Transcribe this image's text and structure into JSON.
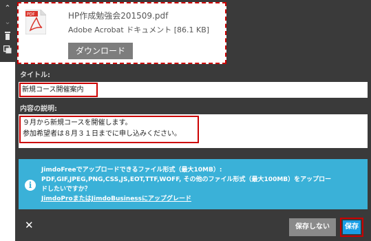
{
  "toolbar": {
    "icons": [
      "chevron-up-icon",
      "chevron-down-icon",
      "trash-icon",
      "duplicate-icon"
    ],
    "up_glyph": "⌃",
    "down_glyph": "⌄",
    "trash_glyph": "🗑",
    "copy_glyph": "⧉"
  },
  "file": {
    "icon_label": "PDF",
    "name": "HP作成勉強会201509.pdf",
    "type": "Adobe Acrobat ドキュメント [86.1 KB]",
    "download_label": "ダウンロード"
  },
  "form": {
    "title_label": "タイトル:",
    "title_value": "新規コース開催案内",
    "description_label": "内容の説明:",
    "description_lines": [
      "９月から新規コースを開催します。",
      "参加希望者は８月３１日までに申し込みください。"
    ]
  },
  "info": {
    "icon": "i",
    "line1": "JimdoFreeでアップロードできるファイル形式（最大10MB）:",
    "line2": "PDF,GIF,JPEG,PNG,CSS,JS,EOT,TTF,WOFF, その他のファイル形式（最大100MB）をアップロー",
    "line3": "ドしたいですか？",
    "link": "JimdoProまたはJimdoBusinessにアップグレード"
  },
  "actions": {
    "close_label": "✕",
    "nosave_label": "保存しない",
    "save_label": "保存"
  },
  "colors": {
    "panel_bg": "#3a3a3a",
    "highlight": "#cc0000",
    "info_bg": "#3ab1d8",
    "save_bg": "#1a9ee5"
  }
}
